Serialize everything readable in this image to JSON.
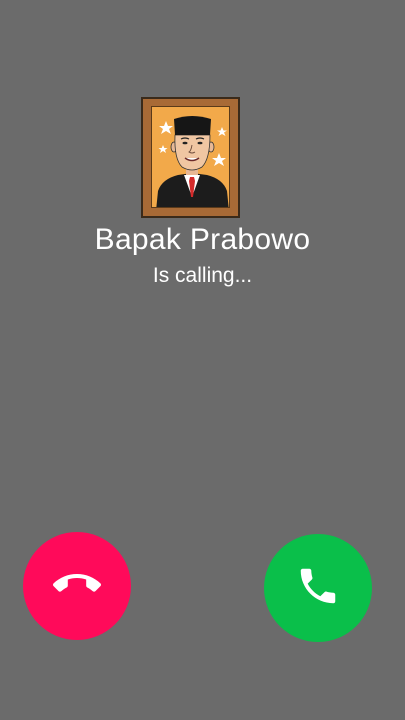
{
  "caller": {
    "name": "Bapak Prabowo",
    "status": "Is calling..."
  },
  "buttons": {
    "decline_icon": "phone-hangup-icon",
    "accept_icon": "phone-icon",
    "decline_color": "#ff0a5a",
    "accept_color": "#0abf4a"
  },
  "colors": {
    "background": "#6b6b6b",
    "frame": "#a86a36",
    "portrait_bg": "#f2a94a"
  }
}
